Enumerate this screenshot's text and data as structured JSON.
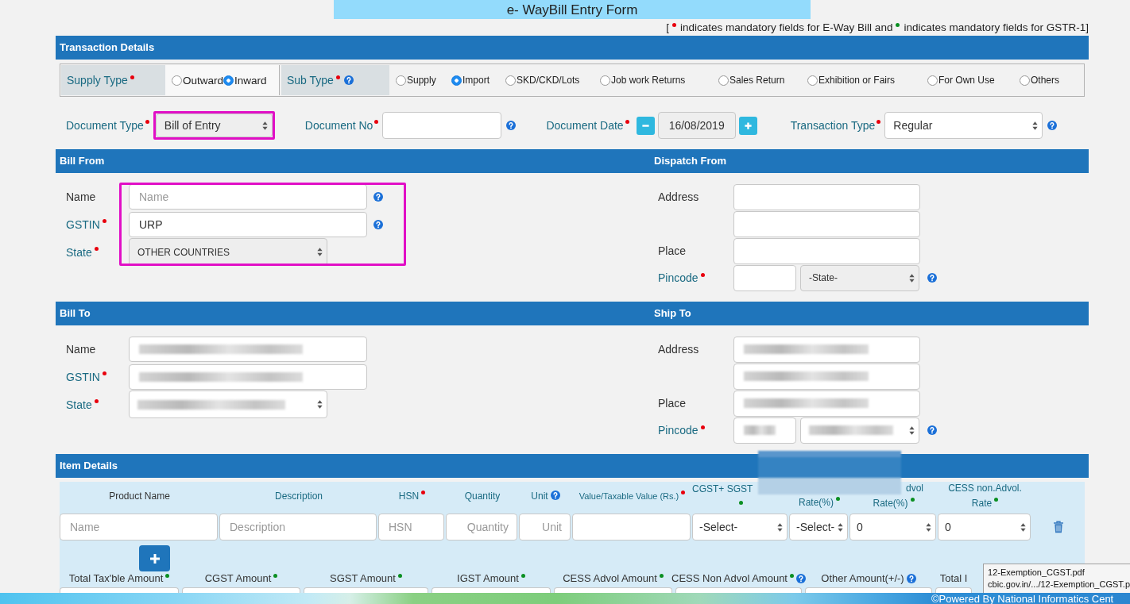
{
  "title": "e- WayBill Entry Form",
  "legend": {
    "open": "[",
    "notes": [
      {
        "color": "#e8000d",
        "text": "indicates mandatory fields for E-Way Bill and"
      },
      {
        "color": "#0b8f22",
        "text": "indicates mandatory fields for GSTR-1]"
      }
    ]
  },
  "transaction_details": {
    "title": "Transaction Details",
    "supply_type": {
      "label": "Supply Type",
      "accent": true,
      "eway_mandatory": true,
      "options": [
        {
          "label": "Outward",
          "selected": false
        },
        {
          "label": "Inward",
          "selected": true
        }
      ]
    },
    "sub_type": {
      "label": "Sub Type",
      "accent": true,
      "eway_mandatory": true,
      "help": true,
      "options": [
        {
          "label": "Supply",
          "selected": false
        },
        {
          "label": "Import",
          "selected": true
        },
        {
          "label": "SKD/CKD/Lots",
          "selected": false
        },
        {
          "label": "Job work Returns",
          "selected": false
        },
        {
          "label": "Sales Return",
          "selected": false
        },
        {
          "label": "Exhibition or Fairs",
          "selected": false
        },
        {
          "label": "For Own Use",
          "selected": false
        },
        {
          "label": "Others",
          "selected": false
        }
      ]
    },
    "document_fields": [
      {
        "kind": "select",
        "label": "Document Type",
        "accent": true,
        "eway_mandatory": true,
        "value": "Bill of Entry",
        "disabled": true,
        "highlighted": true
      },
      {
        "kind": "input",
        "label": "Document No",
        "accent": true,
        "eway_mandatory": true,
        "help": true,
        "disabled": false,
        "highlighted": false
      },
      {
        "kind": "date",
        "label": "Document Date",
        "accent": true,
        "eway_mandatory": true,
        "value": "16/08/2019",
        "disabled": true,
        "highlighted": false
      },
      {
        "kind": "select",
        "label": "Transaction Type",
        "accent": true,
        "eway_mandatory": true,
        "value": "Regular",
        "help": true,
        "disabled": false,
        "highlighted": false
      }
    ]
  },
  "bill_from": {
    "title": "Bill From",
    "highlighted": true,
    "fields": [
      {
        "kind": "input",
        "label": "Name",
        "accent": false,
        "eway_mandatory": false,
        "placeholder": "Name",
        "help": true,
        "disabled": false
      },
      {
        "kind": "input",
        "label": "GSTIN",
        "accent": true,
        "eway_mandatory": true,
        "value": "URP",
        "help": true,
        "disabled": false
      },
      {
        "kind": "select",
        "label": "State",
        "accent": true,
        "eway_mandatory": true,
        "value": "OTHER COUNTRIES",
        "disabled": true
      }
    ]
  },
  "dispatch_from": {
    "title": "Dispatch From",
    "fields": [
      {
        "kind": "input",
        "label": "Address",
        "accent": false,
        "eway_mandatory": false,
        "disabled": false
      },
      {
        "kind": "input",
        "disabled": false
      },
      {
        "kind": "input",
        "label": "Place",
        "accent": false,
        "eway_mandatory": false,
        "disabled": false
      },
      {
        "kind": "pincode_state",
        "label": "Pincode",
        "accent": true,
        "eway_mandatory": true,
        "state": "-State-",
        "help": true,
        "disabled": true
      }
    ]
  },
  "bill_to": {
    "title": "Bill To",
    "fields": [
      {
        "kind": "input",
        "label": "Name",
        "accent": false,
        "eway_mandatory": false,
        "redacted": true
      },
      {
        "kind": "input",
        "label": "GSTIN",
        "accent": true,
        "eway_mandatory": true,
        "redacted": true
      },
      {
        "kind": "select",
        "label": "State",
        "accent": true,
        "eway_mandatory": true,
        "redacted": true
      }
    ]
  },
  "ship_to": {
    "title": "Ship To",
    "fields": [
      {
        "kind": "input",
        "label": "Address",
        "accent": false,
        "eway_mandatory": false,
        "redacted": true
      },
      {
        "kind": "input",
        "redacted": true
      },
      {
        "kind": "input",
        "label": "Place",
        "accent": false,
        "eway_mandatory": false,
        "redacted": true
      },
      {
        "kind": "pincode_state",
        "label": "Pincode",
        "accent": true,
        "eway_mandatory": true,
        "redacted": true,
        "help": true
      }
    ]
  },
  "item_details": {
    "title": "Item Details",
    "columns": [
      {
        "label": "Product Name",
        "accent": false,
        "eway_mandatory": false,
        "gstr_mandatory": false,
        "field": {
          "kind": "input",
          "placeholder": "Name"
        }
      },
      {
        "label": "Description",
        "accent": true,
        "eway_mandatory": false,
        "gstr_mandatory": false,
        "field": {
          "kind": "input",
          "placeholder": "Description"
        }
      },
      {
        "label": "HSN",
        "accent": true,
        "eway_mandatory": true,
        "gstr_mandatory": false,
        "field": {
          "kind": "input",
          "placeholder": "HSN"
        }
      },
      {
        "label": "Quantity",
        "accent": true,
        "eway_mandatory": false,
        "gstr_mandatory": false,
        "field": {
          "kind": "input",
          "placeholder": "Quantity",
          "right_aligned": true
        }
      },
      {
        "label": "Unit",
        "accent": true,
        "eway_mandatory": false,
        "gstr_mandatory": false,
        "help": true,
        "field": {
          "kind": "input",
          "placeholder": "Unit",
          "right_aligned": true
        }
      },
      {
        "label": "Value/Taxable Value (Rs.)",
        "accent": true,
        "compact": true,
        "eway_mandatory": true,
        "gstr_mandatory": false,
        "field": {
          "kind": "input"
        }
      },
      {
        "label": "CGST+ SGST",
        "accent": true,
        "eway_mandatory": false,
        "gstr_mandatory": true,
        "redacted_end": true,
        "field": {
          "kind": "select",
          "value": "-Select-"
        }
      },
      {
        "label": "Rate(%)",
        "accent": true,
        "eway_mandatory": false,
        "gstr_mandatory": true,
        "redacted_start": true,
        "field": {
          "kind": "select",
          "value": "-Select-"
        }
      },
      {
        "label": "dvol Rate(%)",
        "accent": true,
        "eway_mandatory": false,
        "gstr_mandatory": true,
        "redacted_start": true,
        "field": {
          "kind": "select",
          "value": "0"
        }
      },
      {
        "label": "CESS non.Advol. Rate",
        "accent": true,
        "eway_mandatory": false,
        "gstr_mandatory": true,
        "field": {
          "kind": "select",
          "value": "0"
        }
      }
    ],
    "totals": [
      {
        "label": "Total Tax'ble Amount",
        "gstr_mandatory": true
      },
      {
        "label": "CGST Amount",
        "gstr_mandatory": true
      },
      {
        "label": "SGST Amount",
        "gstr_mandatory": true
      },
      {
        "label": "IGST Amount",
        "gstr_mandatory": true
      },
      {
        "label": "CESS Advol Amount",
        "gstr_mandatory": true
      },
      {
        "label": "CESS Non Advol Amount",
        "gstr_mandatory": true,
        "help": true
      },
      {
        "label": "Other Amount(+/-)",
        "gstr_mandatory": false,
        "help": true
      },
      {
        "label": "Total I",
        "gstr_mandatory": false
      }
    ]
  },
  "tooltip": {
    "lines": [
      "12-Exemption_CGST.pdf",
      "cbic.gov.in/.../12-Exemption_CGST.p"
    ]
  },
  "footer": {
    "text": "©Powered By National Informatics Cent"
  }
}
